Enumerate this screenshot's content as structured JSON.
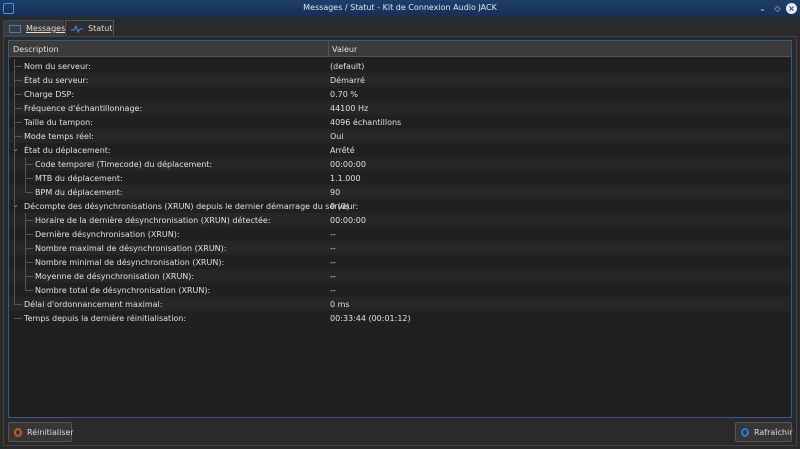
{
  "window": {
    "title": "Messages / Statut - Kit de Connexion Audio JACK"
  },
  "tabs": [
    {
      "label": "Messages"
    },
    {
      "label": "Statut"
    }
  ],
  "table": {
    "headers": [
      "Description",
      "Valeur"
    ],
    "rows": [
      {
        "desc": "Nom du serveur:",
        "value": "(default)",
        "level": 0
      },
      {
        "desc": "État du serveur:",
        "value": "Démarré",
        "level": 0
      },
      {
        "desc": "Charge DSP:",
        "value": "0.70 %",
        "level": 0
      },
      {
        "desc": "Fréquence d'échantillonnage:",
        "value": "44100 Hz",
        "level": 0
      },
      {
        "desc": "Taille du tampon:",
        "value": "4096 échantillons",
        "level": 0
      },
      {
        "desc": "Mode temps réel:",
        "value": "Oui",
        "level": 0
      },
      {
        "desc": "État du déplacement:",
        "value": "Arrêté",
        "level": 0,
        "expanded": true
      },
      {
        "desc": "Code temporel (Timecode) du déplacement:",
        "value": "00:00:00",
        "level": 1
      },
      {
        "desc": "MTB du déplacement:",
        "value": "1.1.000",
        "level": 1
      },
      {
        "desc": "BPM du déplacement:",
        "value": "90",
        "level": 1
      },
      {
        "desc": "Décompte des désynchronisations (XRUN) depuis le dernier démarrage du serveur:",
        "value": "0 (0)",
        "level": 0,
        "expanded": true
      },
      {
        "desc": "Horaire de la dernière désynchronisation (XRUN) détectée:",
        "value": "00:00:00",
        "level": 1
      },
      {
        "desc": "Dernière désynchronisation (XRUN):",
        "value": "--",
        "level": 1
      },
      {
        "desc": "Nombre maximal de désynchronisation (XRUN):",
        "value": "--",
        "level": 1
      },
      {
        "desc": "Nombre minimal de désynchronisation (XRUN):",
        "value": "--",
        "level": 1
      },
      {
        "desc": "Moyenne de désynchronisation (XRUN):",
        "value": "--",
        "level": 1
      },
      {
        "desc": "Nombre total de désynchronisation (XRUN):",
        "value": "--",
        "level": 1
      },
      {
        "desc": "Délai d'ordonnancement maximal:",
        "value": "0 ms",
        "level": 0
      },
      {
        "desc": "Temps depuis la dernière réinitialisation:",
        "value": "00:33:44 (00:01:12)",
        "level": 0
      }
    ]
  },
  "buttons": {
    "reset": "Réinitialiser",
    "refresh": "Rafraîchir"
  },
  "colors": {
    "accent": "#2f5b8f",
    "titlebar": "#1d3f6e",
    "reset_icon": "#d9531e",
    "refresh_icon": "#2a7fd4"
  }
}
